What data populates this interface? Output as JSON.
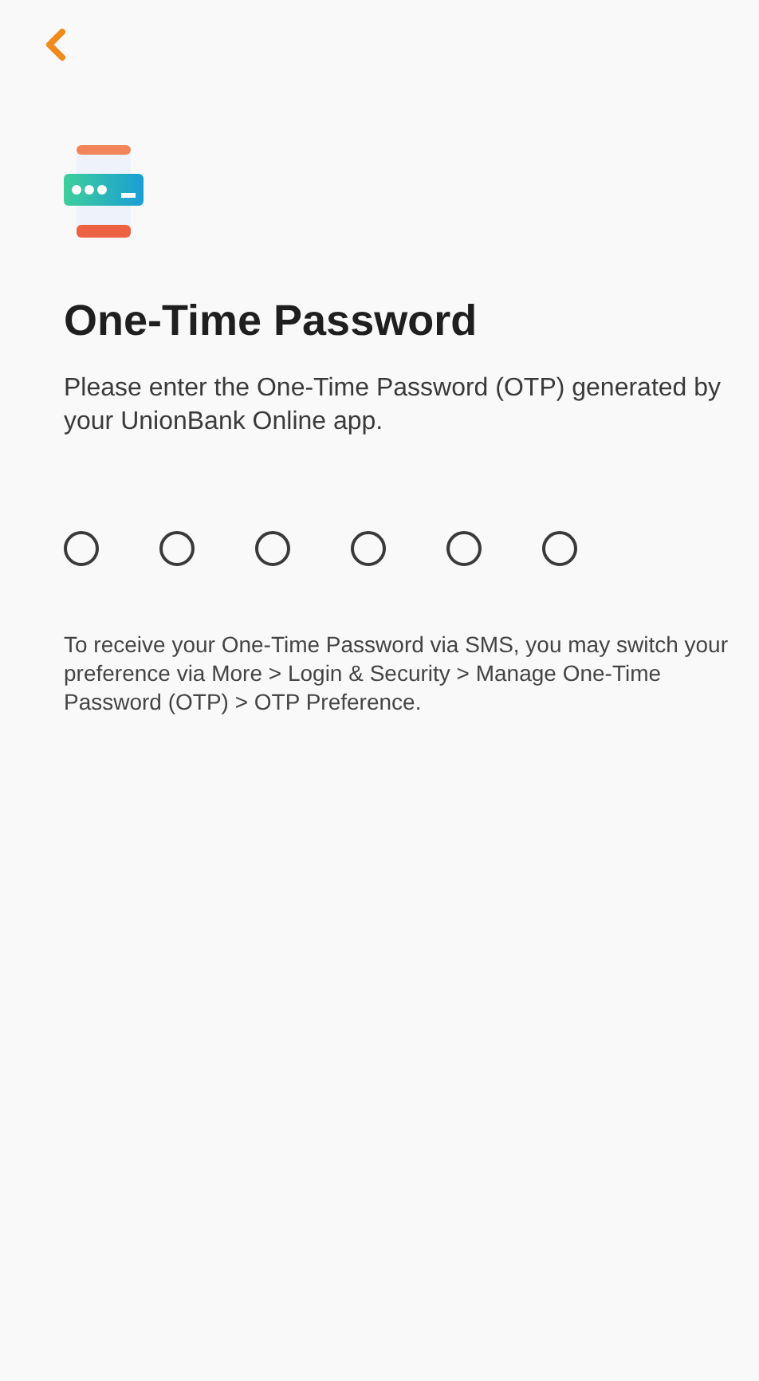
{
  "title": "One-Time Password",
  "subtitle": "Please enter the One-Time Password (OTP) generated by your UnionBank Online app.",
  "otp_digits": [
    {
      "filled": false
    },
    {
      "filled": false
    },
    {
      "filled": false
    },
    {
      "filled": false
    },
    {
      "filled": false
    },
    {
      "filled": false
    }
  ],
  "note": "To receive your One-Time Password via SMS, you may switch your preference via More > Login & Security > Manage One-Time Password (OTP) > OTP Preference."
}
